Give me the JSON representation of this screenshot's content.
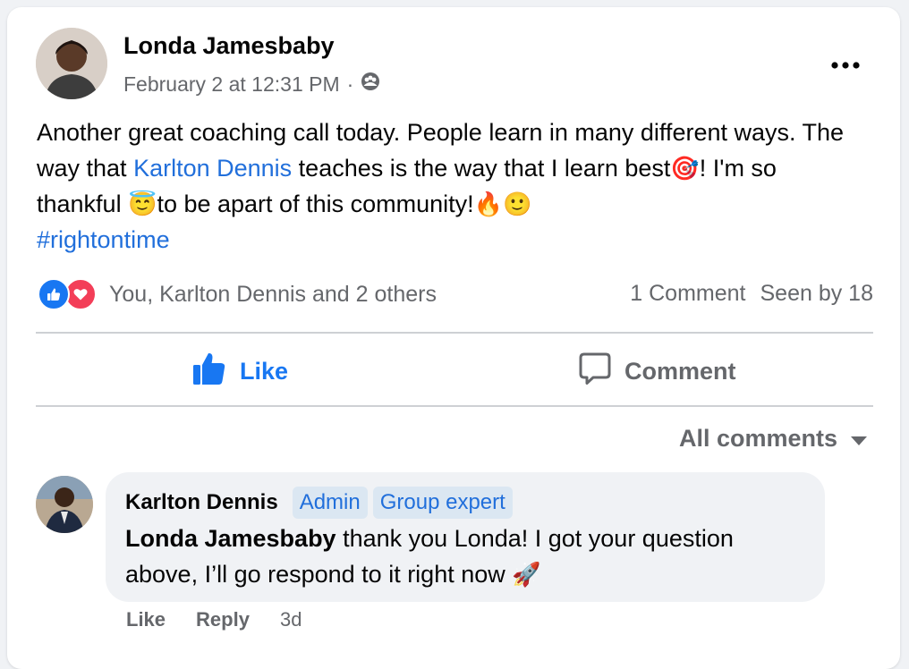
{
  "post": {
    "author": "Londa Jamesbaby",
    "timestamp": "February 2 at 12:31 PM",
    "separator": "·",
    "privacy_icon": "group-icon",
    "text_part1": "Another great coaching call today. People learn in many different ways. The way that ",
    "mention": "Karlton Dennis",
    "text_part2": " teaches is the way that I learn best",
    "emoji1": "🎯",
    "text_part3": "! I'm so thankful ",
    "emoji2": "😇",
    "text_part4": "to be apart of this community!",
    "emoji3": "🔥",
    "emoji4": "🙂",
    "hashtag": "#rightontime"
  },
  "reactions": {
    "summary": "You, Karlton Dennis and 2 others",
    "comments_count": "1 Comment",
    "seen_by": "Seen by 18"
  },
  "actions": {
    "like": "Like",
    "comment": "Comment"
  },
  "comments_sort": "All comments",
  "comment": {
    "author": "Karlton Dennis",
    "badges": [
      "Admin",
      "Group expert"
    ],
    "mention": "Londa Jamesbaby",
    "text": " thank you Londa! I got your question above, I’ll go respond to it right now ",
    "emoji": "🚀",
    "like": "Like",
    "reply": "Reply",
    "time": "3d"
  },
  "colors": {
    "accent": "#1877f2",
    "link": "#216fdb",
    "secondary_text": "#65676b",
    "love": "#f33e58"
  }
}
